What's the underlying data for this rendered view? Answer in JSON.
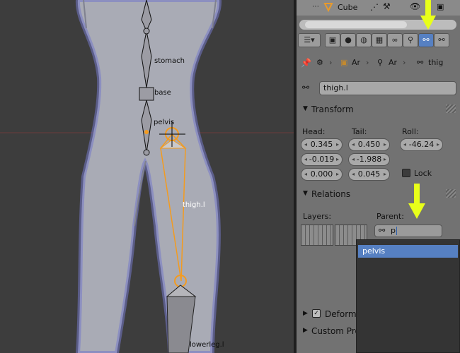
{
  "viewport": {
    "bones": [
      {
        "label": "stomach",
        "selected": false
      },
      {
        "label": "base",
        "selected": false
      },
      {
        "label": "pelvis",
        "selected": false
      },
      {
        "label": "thigh.l",
        "selected": true
      },
      {
        "label": "lowerleg.l",
        "selected": false
      }
    ]
  },
  "outliner": {
    "object_name": "Cube"
  },
  "properties": {
    "context_tabs": [
      {
        "icon": "render-icon",
        "glyph": "▣"
      },
      {
        "icon": "scene-icon",
        "glyph": "●"
      },
      {
        "icon": "world-icon",
        "glyph": "◍"
      },
      {
        "icon": "object-icon",
        "glyph": "▦"
      },
      {
        "icon": "constraints-icon",
        "glyph": "∞"
      },
      {
        "icon": "armature-data-icon",
        "glyph": "⚲"
      },
      {
        "icon": "bone-icon",
        "glyph": "⚯",
        "active": true
      },
      {
        "icon": "bone-constraint-icon",
        "glyph": "⚯"
      }
    ],
    "breadcrumbs": [
      "Ar",
      "Ar",
      "thig"
    ],
    "bone_name": "thigh.l",
    "transform": {
      "title": "Transform",
      "head_label": "Head:",
      "tail_label": "Tail:",
      "roll_label": "Roll:",
      "head": [
        "0.345",
        "-0.019",
        "0.000"
      ],
      "tail": [
        "0.450",
        "-1.988",
        "0.045"
      ],
      "roll": "-46.24",
      "lock_label": "Lock"
    },
    "relations": {
      "title": "Relations",
      "layers_label": "Layers:",
      "parent_label": "Parent:",
      "parent_value": "p",
      "dropdown_items": [
        "pelvis"
      ]
    },
    "deform": {
      "title": "Deform"
    },
    "custom_props": {
      "title": "Custom Pro"
    }
  },
  "colors": {
    "highlight_arrow": "#e8ff1a",
    "selected_bone": "#f39b1f",
    "accent_blue": "#5680c2"
  }
}
